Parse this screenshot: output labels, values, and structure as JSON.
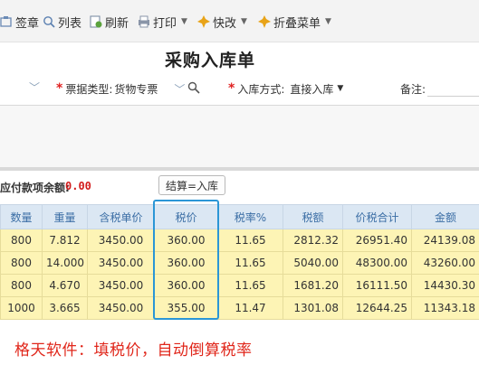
{
  "toolbar": {
    "items": [
      {
        "label": "签章",
        "icon": "stamp-icon"
      },
      {
        "label": "列表",
        "icon": "list-icon"
      },
      {
        "label": "刷新",
        "icon": "refresh-icon"
      },
      {
        "label": "打印",
        "icon": "printer-icon"
      },
      {
        "label": "快改",
        "icon": "quick-edit-icon"
      },
      {
        "label": "折叠菜单",
        "icon": "collapse-menu-icon"
      }
    ]
  },
  "page": {
    "title": "采购入库单"
  },
  "form": {
    "invoice_type_label": "票据类型:",
    "invoice_type_value": "货物专票",
    "stock_method_label": "入库方式:",
    "stock_method_value": "直接入库",
    "remark_label": "备注:"
  },
  "payment": {
    "label": "应付款项余额:",
    "value": "0.00"
  },
  "calc_button": {
    "label": "结算=入库"
  },
  "table": {
    "headers": [
      "数量",
      "重量",
      "含税单价",
      "税价",
      "税率%",
      "税额",
      "价税合计",
      "金额"
    ],
    "rows": [
      [
        "800",
        "7.812",
        "3450.00",
        "360.00",
        "11.65",
        "2812.32",
        "26951.40",
        "24139.08"
      ],
      [
        "800",
        "14.000",
        "3450.00",
        "360.00",
        "11.65",
        "5040.00",
        "48300.00",
        "43260.00"
      ],
      [
        "800",
        "4.670",
        "3450.00",
        "360.00",
        "11.65",
        "1681.20",
        "16111.50",
        "14430.30"
      ],
      [
        "1000",
        "3.665",
        "3450.00",
        "355.00",
        "11.47",
        "1301.08",
        "12644.25",
        "11343.18"
      ]
    ]
  },
  "caption": "格天软件：填税价，自动倒算税率",
  "colors": {
    "accent": "#2b96d6",
    "header_bg": "#dbe7f3",
    "row_bg": "#fdf4b5",
    "caption": "#e0261a"
  }
}
